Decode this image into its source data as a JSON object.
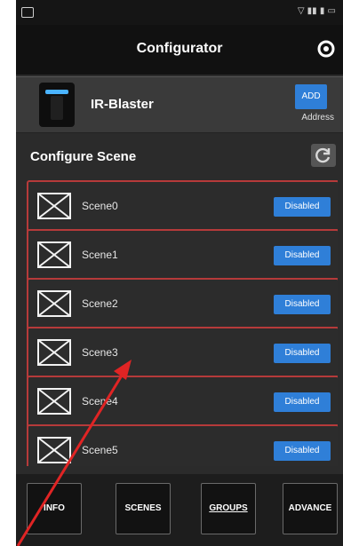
{
  "app": {
    "title": "Configurator"
  },
  "device": {
    "name": "IR-Blaster",
    "address_button": "ADD",
    "address_label": "Address"
  },
  "section": {
    "title": "Configure Scene"
  },
  "scenes": [
    {
      "name": "Scene0",
      "status": "Disabled"
    },
    {
      "name": "Scene1",
      "status": "Disabled"
    },
    {
      "name": "Scene2",
      "status": "Disabled"
    },
    {
      "name": "Scene3",
      "status": "Disabled"
    },
    {
      "name": "Scene4",
      "status": "Disabled"
    },
    {
      "name": "Scene5",
      "status": "Disabled"
    }
  ],
  "tabs": [
    {
      "label": "INFO"
    },
    {
      "label": "SCENES"
    },
    {
      "label": "GROUPS",
      "active": true
    },
    {
      "label": "ADVANCE"
    }
  ],
  "colors": {
    "accent": "#2f7fd8",
    "border": "#b63a3a",
    "annotation": "#e02424"
  }
}
